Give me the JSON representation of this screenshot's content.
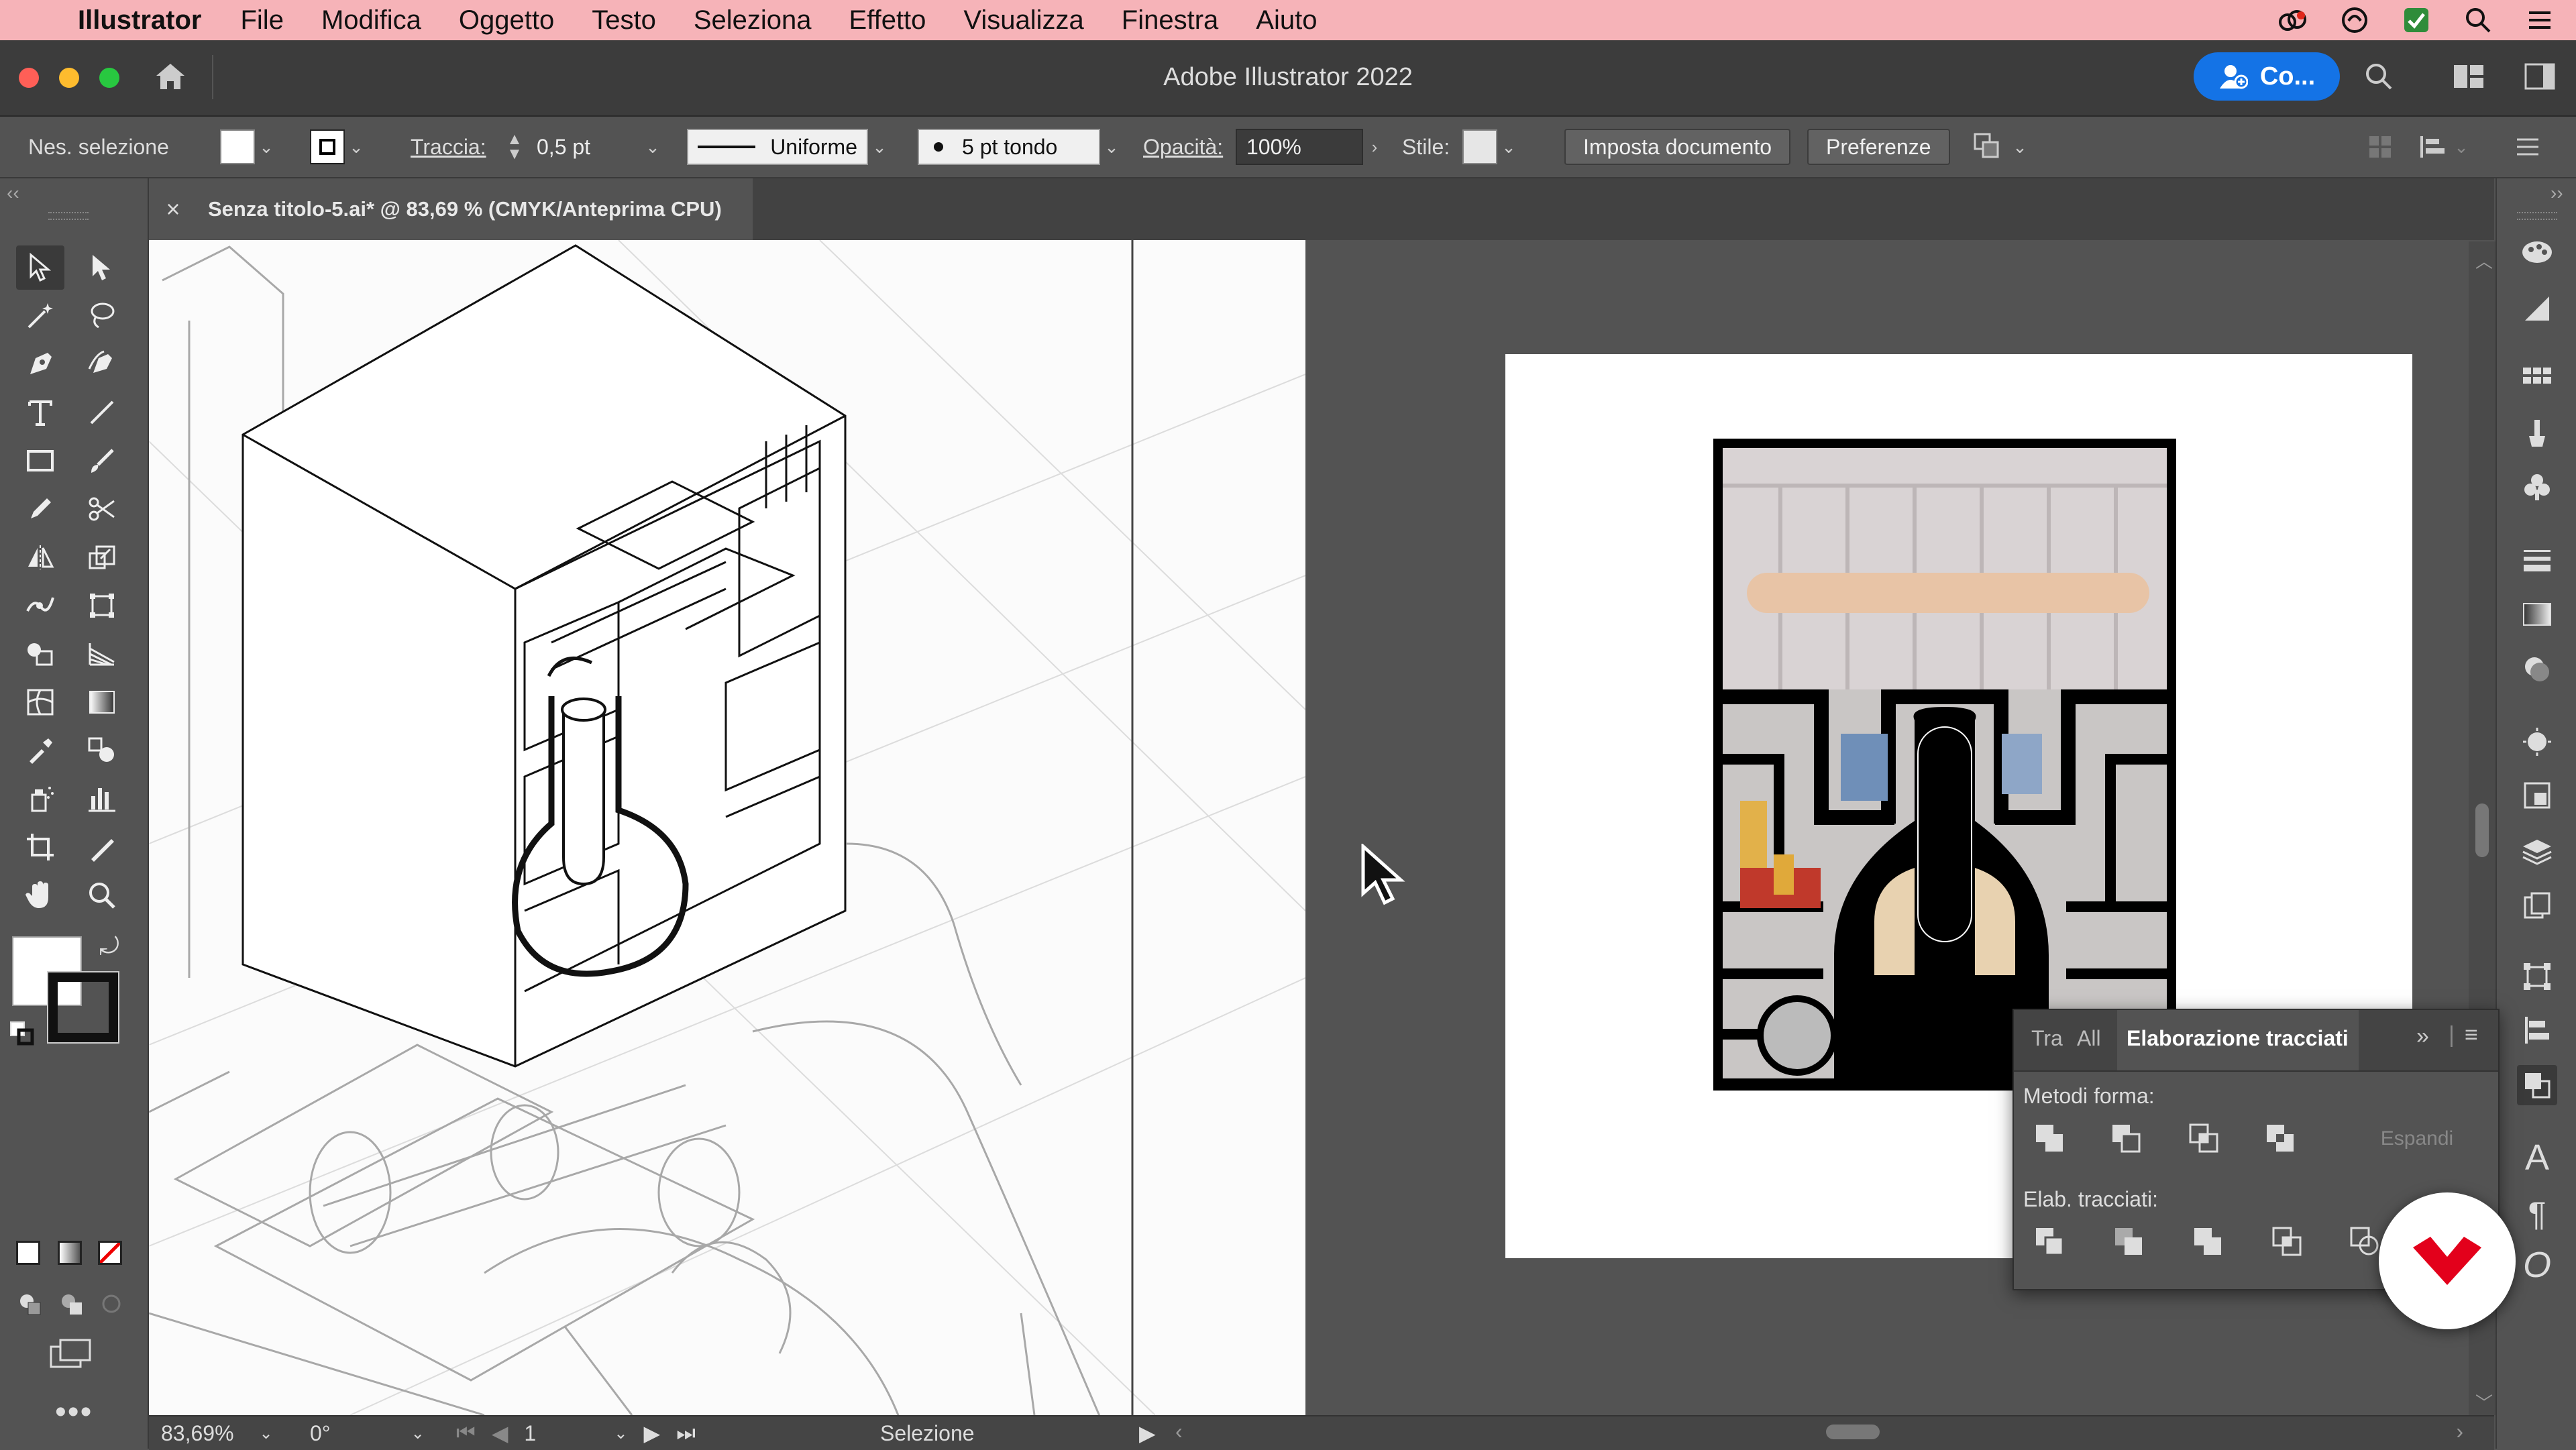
{
  "menubar": {
    "apple": "",
    "app": "Illustrator",
    "items": [
      "File",
      "Modifica",
      "Oggetto",
      "Testo",
      "Seleziona",
      "Effetto",
      "Visualizza",
      "Finestra",
      "Aiuto"
    ]
  },
  "window": {
    "title": "Adobe Illustrator 2022",
    "share_button": "Co..."
  },
  "control_bar": {
    "selection": "Nes. selezione",
    "stroke_label": "Traccia:",
    "stroke_weight": "0,5 pt",
    "profile": "Uniforme",
    "brush": "5 pt tondo",
    "opacity_label": "Opacità:",
    "opacity_value": "100%",
    "style_label": "Stile:",
    "document_setup": "Imposta documento",
    "preferences": "Preferenze"
  },
  "document_tab": {
    "close": "×",
    "title": "Senza titolo-5.ai* @ 83,69 % (CMYK/Anteprima CPU)"
  },
  "status_bar": {
    "zoom": "83,69%",
    "rotation": "0°",
    "artboard": "1",
    "tool": "Selezione"
  },
  "pathfinder": {
    "tabs": [
      "Tra",
      "All",
      "Elaborazione tracciati"
    ],
    "shape_modes_label": "Metodi forma:",
    "expand": "Espandi",
    "pathfinders_label": "Elab. tracciati:"
  },
  "colors": {
    "menubar": "#f6b3b8",
    "accent": "#1473e6",
    "ui_bg": "#535353",
    "badge_red": "#e3001b"
  }
}
